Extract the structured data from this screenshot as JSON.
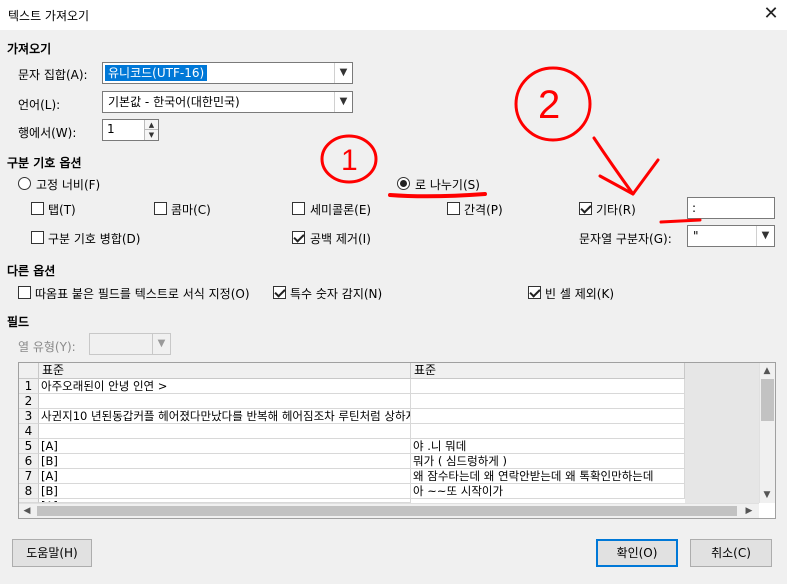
{
  "window": {
    "title": "텍스트 가져오기",
    "close_symbol": "✕"
  },
  "import": {
    "section": "가져오기",
    "charset_label": "문자 집합(A):",
    "charset_value": "유니코드(UTF-16)",
    "language_label": "언어(L):",
    "language_value": "기본값 - 한국어(대한민국)",
    "from_row_label": "행에서(W):",
    "from_row_value": "1"
  },
  "separator": {
    "section": "구분 기호 옵션",
    "fixed_width": "고정 너비(F)",
    "separated_by": "로 나누기(S)",
    "tab": "탭(T)",
    "comma": "콤마(C)",
    "semicolon": "세미콜론(E)",
    "space": "간격(P)",
    "other": "기타(R)",
    "other_value": ":",
    "merge": "구분 기호 병합(D)",
    "trim_spaces": "공백 제거(I)",
    "string_delimiter_label": "문자열 구분자(G):",
    "string_delimiter_value": "\""
  },
  "other_options": {
    "section": "다른 옵션",
    "quoted_as_text": "따옴표 붙은 필드를 텍스트로 서식 지정(O)",
    "detect_special": "특수 숫자 감지(N)",
    "skip_empty": "빈 셀 제외(K)"
  },
  "fields": {
    "section": "필드",
    "column_type_label": "열 유형(Y):",
    "headers": [
      "표준",
      "표준"
    ],
    "rows": [
      {
        "num": "1",
        "c1": "아주오래된이 안녕 인연 >",
        "c2": ""
      },
      {
        "num": "2",
        "c1": "",
        "c2": ""
      },
      {
        "num": "3",
        "c1": "사귄지10 년된동갑커플 헤어졌다만났다를 반복해 헤어짐조차 루틴처럼 상하지루하다",
        "c2": ""
      },
      {
        "num": "4",
        "c1": "",
        "c2": ""
      },
      {
        "num": "5",
        "c1": "[A]",
        "c2": "야 .니 뭐데"
      },
      {
        "num": "6",
        "c1": "[B]",
        "c2": "뭐가 ( 심드렁하게 )"
      },
      {
        "num": "7",
        "c1": "[A]",
        "c2": "왜 잠수타는데 왜 연락안받는데 왜 톡확인만하는데"
      },
      {
        "num": "8",
        "c1": "[B]",
        "c2": "아 ~~또 시작이가"
      },
      {
        "num": "",
        "c1": "[A]",
        "c2": ""
      }
    ]
  },
  "buttons": {
    "help": "도움말(H)",
    "ok": "확인(O)",
    "cancel": "취소(C)"
  },
  "annotations": {
    "circle_one": "①",
    "circle_two": "②"
  },
  "colors": {
    "accent": "#0078d7",
    "annotation": "#ff0000"
  }
}
